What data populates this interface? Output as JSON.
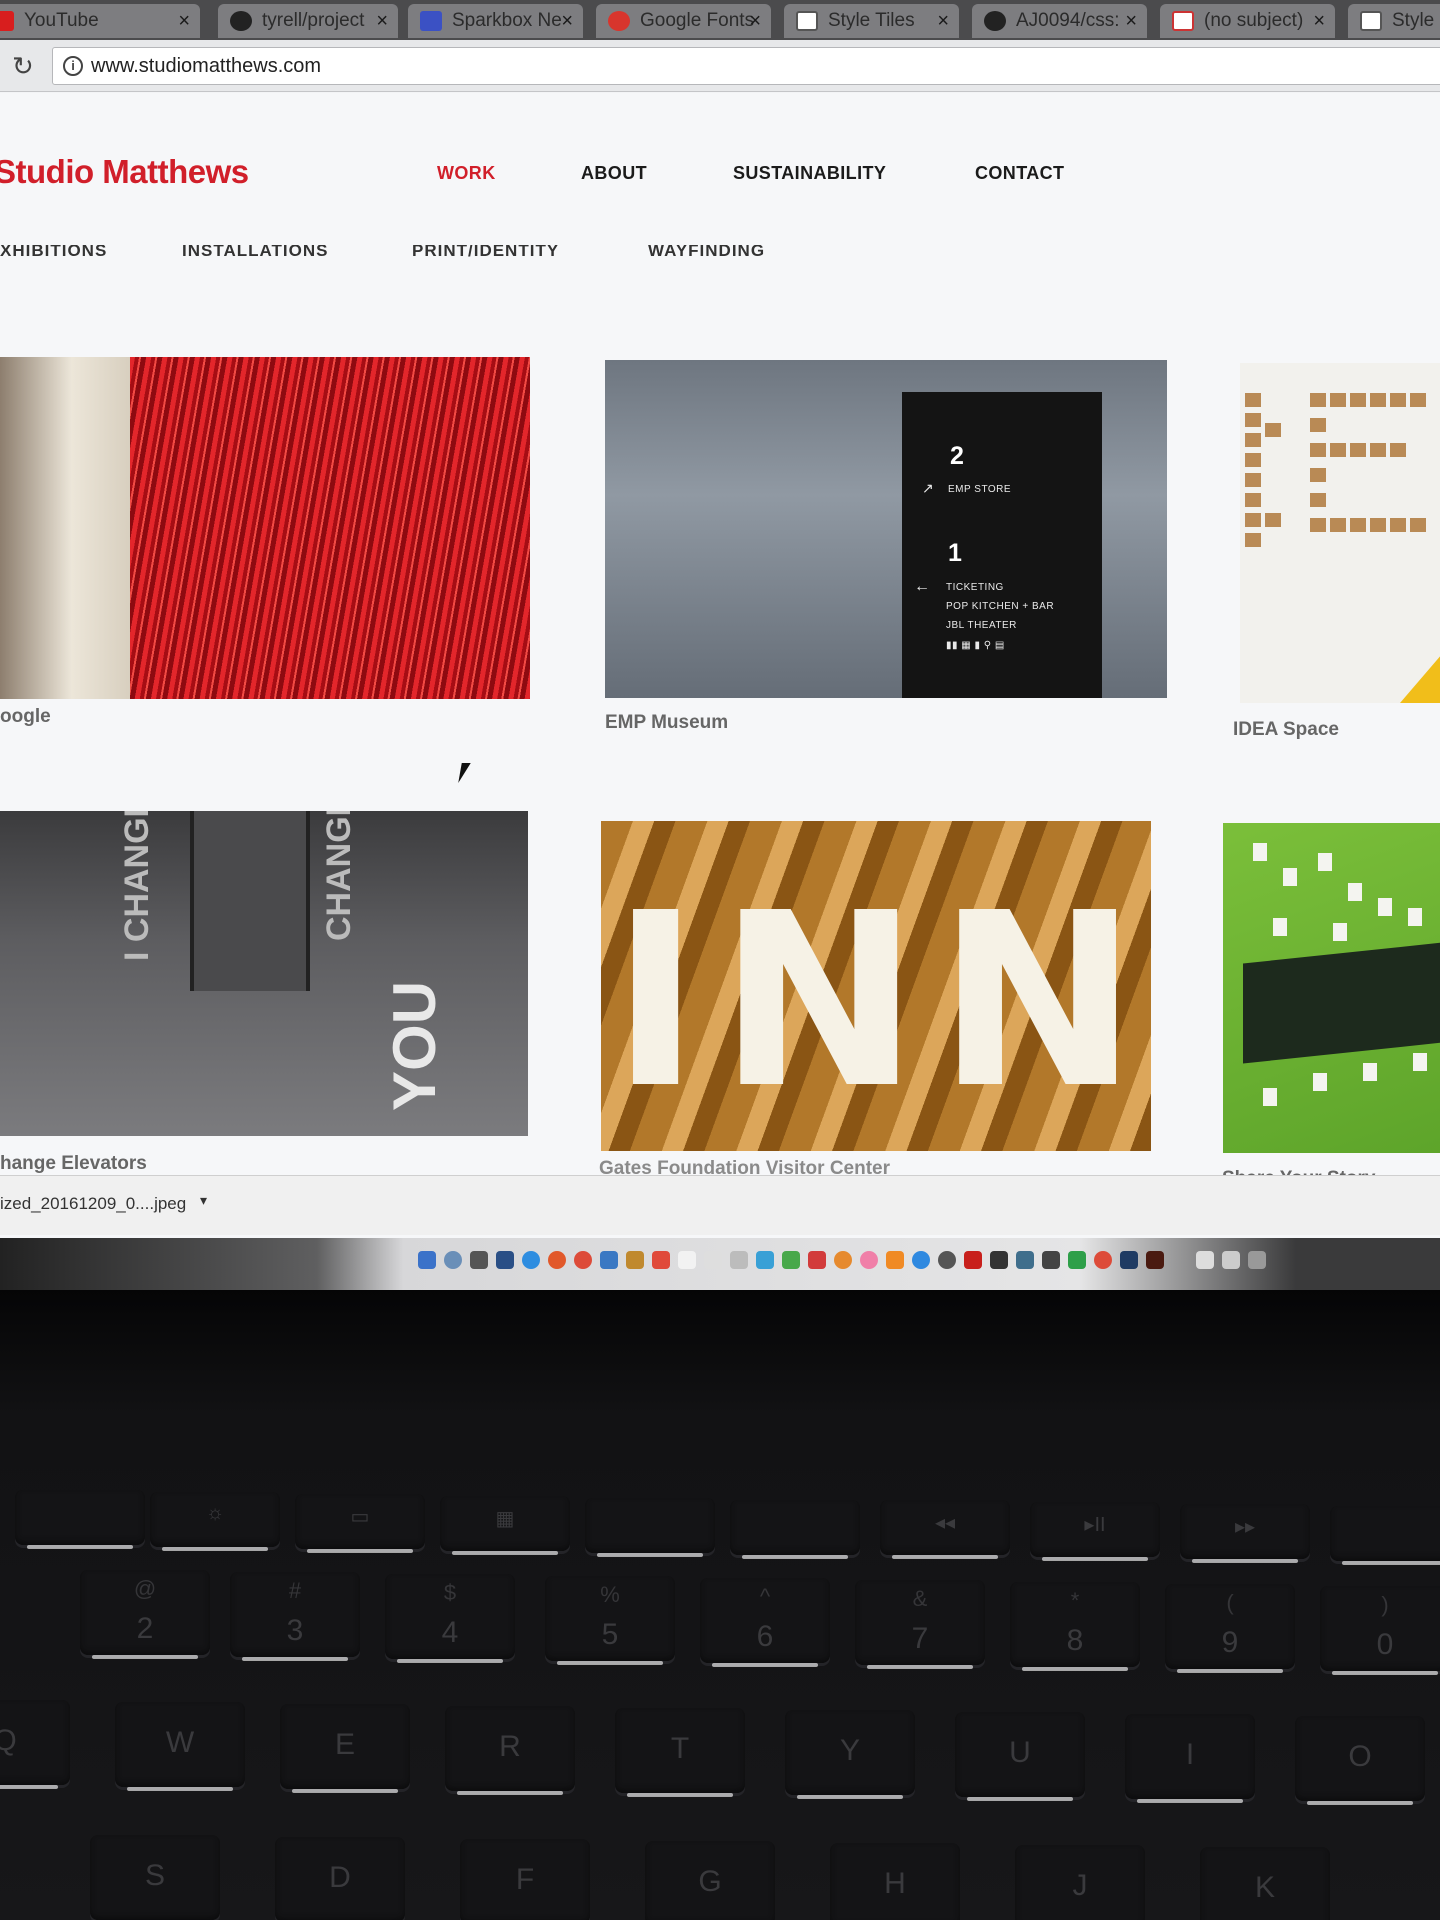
{
  "browser": {
    "tabs": [
      {
        "title": "YouTube",
        "favicon": "youtube-icon"
      },
      {
        "title": "tyrell/project",
        "favicon": "github-icon"
      },
      {
        "title": "Sparkbox Ne",
        "favicon": "docs-icon"
      },
      {
        "title": "Google Fonts",
        "favicon": "google-fonts-icon"
      },
      {
        "title": "Style Tiles",
        "favicon": "sheet-icon"
      },
      {
        "title": "AJ0094/css:",
        "favicon": "github-icon"
      },
      {
        "title": "(no subject)",
        "favicon": "gmail-icon"
      },
      {
        "title": "Style",
        "favicon": "sheet-icon"
      }
    ],
    "url": "www.studiomatthews.com"
  },
  "site": {
    "logo": "Studio Matthews",
    "brand_color": "#d11f2a",
    "nav": [
      {
        "label": "WORK",
        "active": true
      },
      {
        "label": "ABOUT",
        "active": false
      },
      {
        "label": "SUSTAINABILITY",
        "active": false
      },
      {
        "label": "CONTACT",
        "active": false
      }
    ],
    "subnav": [
      "XHIBITIONS",
      "INSTALLATIONS",
      "PRINT/IDENTITY",
      "WAYFINDING"
    ]
  },
  "projects": [
    {
      "caption": "oogle"
    },
    {
      "caption": "EMP Museum"
    },
    {
      "caption": "IDEA Space"
    },
    {
      "caption": "hange Elevators"
    },
    {
      "caption": "Gates Foundation Visitor Center"
    },
    {
      "caption": "Share Your Story"
    }
  ],
  "emp_sign": {
    "level2_number": "2",
    "level2_label": "EMP STORE",
    "level1_number": "1",
    "level1_lines": [
      "TICKETING",
      "POP KITCHEN + BAR",
      "JBL THEATER"
    ]
  },
  "elevator_words": {
    "left": "I CHANGE",
    "right": "CHANGE",
    "floor": "YOU"
  },
  "gates_letters": "INN",
  "downloads": {
    "filename": "ized_20161209_0....jpeg"
  },
  "keyboard": {
    "row_numbers": [
      {
        "sym": "@",
        "label": "2"
      },
      {
        "sym": "#",
        "label": "3"
      },
      {
        "sym": "$",
        "label": "4"
      },
      {
        "sym": "%",
        "label": "5"
      },
      {
        "sym": "^",
        "label": "6"
      },
      {
        "sym": "&",
        "label": "7"
      },
      {
        "sym": "*",
        "label": "8"
      },
      {
        "sym": "(",
        "label": "9"
      },
      {
        "sym": ")",
        "label": "0"
      }
    ],
    "row_qwerty": [
      "Q",
      "W",
      "E",
      "R",
      "T",
      "Y",
      "U",
      "I",
      "O"
    ],
    "row_asdf": [
      "S",
      "D",
      "F",
      "G",
      "H",
      "J",
      "K"
    ]
  }
}
